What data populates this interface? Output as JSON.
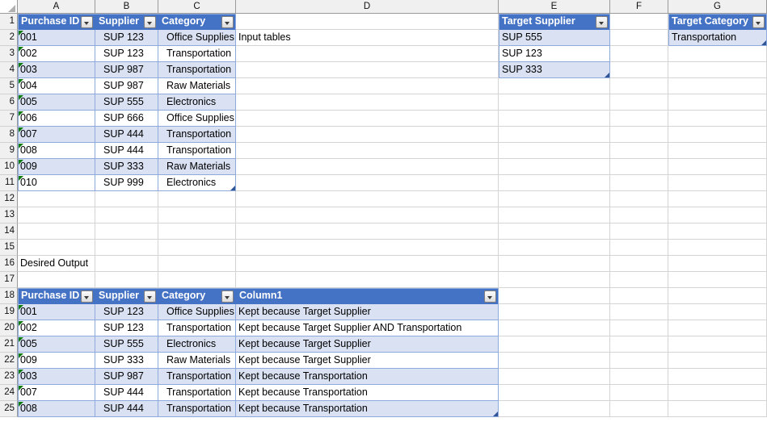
{
  "app": {
    "type": "spreadsheet",
    "colors": {
      "table_header_blue": "#4472C4",
      "table_band_blue": "#D9E1F2",
      "table_border_blue": "#8EA9DB",
      "grid_line": "#D4D4D4",
      "header_bg": "#F0F0F0",
      "error_triangle_green": "#107C10",
      "resize_handle_blue": "#2F5597"
    }
  },
  "grid": {
    "column_headers": [
      "A",
      "B",
      "C",
      "D",
      "E",
      "F",
      "G"
    ],
    "row_headers": [
      "1",
      "2",
      "3",
      "4",
      "5",
      "6",
      "7",
      "8",
      "9",
      "10",
      "11",
      "12",
      "13",
      "14",
      "15",
      "16",
      "17",
      "18",
      "19",
      "20",
      "21",
      "22",
      "23",
      "24",
      "25"
    ],
    "select_all_icon": "select-all-triangle-icon",
    "filter_icon": "filter-dropdown-icon"
  },
  "annotations": {
    "input_tables_label": "Input tables",
    "desired_output_label": "Desired Output"
  },
  "tables": {
    "purchases": {
      "name": "purchases-input-table",
      "headers": [
        "Purchase ID",
        "Supplier",
        "Category"
      ],
      "rows": [
        [
          "001",
          "SUP 123",
          "Office Supplies"
        ],
        [
          "002",
          "SUP 123",
          "Transportation"
        ],
        [
          "003",
          "SUP 987",
          "Transportation"
        ],
        [
          "004",
          "SUP 987",
          "Raw Materials"
        ],
        [
          "005",
          "SUP 555",
          "Electronics"
        ],
        [
          "006",
          "SUP 666",
          "Office Supplies"
        ],
        [
          "007",
          "SUP 444",
          "Transportation"
        ],
        [
          "008",
          "SUP 444",
          "Transportation"
        ],
        [
          "009",
          "SUP 333",
          "Raw Materials"
        ],
        [
          "010",
          "SUP 999",
          "Electronics"
        ]
      ]
    },
    "target_supplier": {
      "name": "target-supplier-table",
      "headers": [
        "Target Supplier"
      ],
      "rows": [
        [
          "SUP 555"
        ],
        [
          "SUP 123"
        ],
        [
          "SUP 333"
        ]
      ]
    },
    "target_category": {
      "name": "target-category-table",
      "headers": [
        "Target Category"
      ],
      "rows": [
        [
          "Transportation"
        ]
      ]
    },
    "desired_output": {
      "name": "desired-output-table",
      "headers": [
        "Purchase ID",
        "Supplier",
        "Category",
        "Column1"
      ],
      "rows": [
        [
          "001",
          "SUP 123",
          "Office Supplies",
          "Kept because Target Supplier"
        ],
        [
          "002",
          "SUP 123",
          "Transportation",
          "Kept because Target Supplier AND Transportation"
        ],
        [
          "005",
          "SUP 555",
          "Electronics",
          "Kept because Target Supplier"
        ],
        [
          "009",
          "SUP 333",
          "Raw Materials",
          "Kept because Target Supplier"
        ],
        [
          "003",
          "SUP 987",
          "Transportation",
          "Kept because Transportation"
        ],
        [
          "007",
          "SUP 444",
          "Transportation",
          "Kept because Transportation"
        ],
        [
          "008",
          "SUP 444",
          "Transportation",
          "Kept because Transportation"
        ]
      ]
    }
  }
}
